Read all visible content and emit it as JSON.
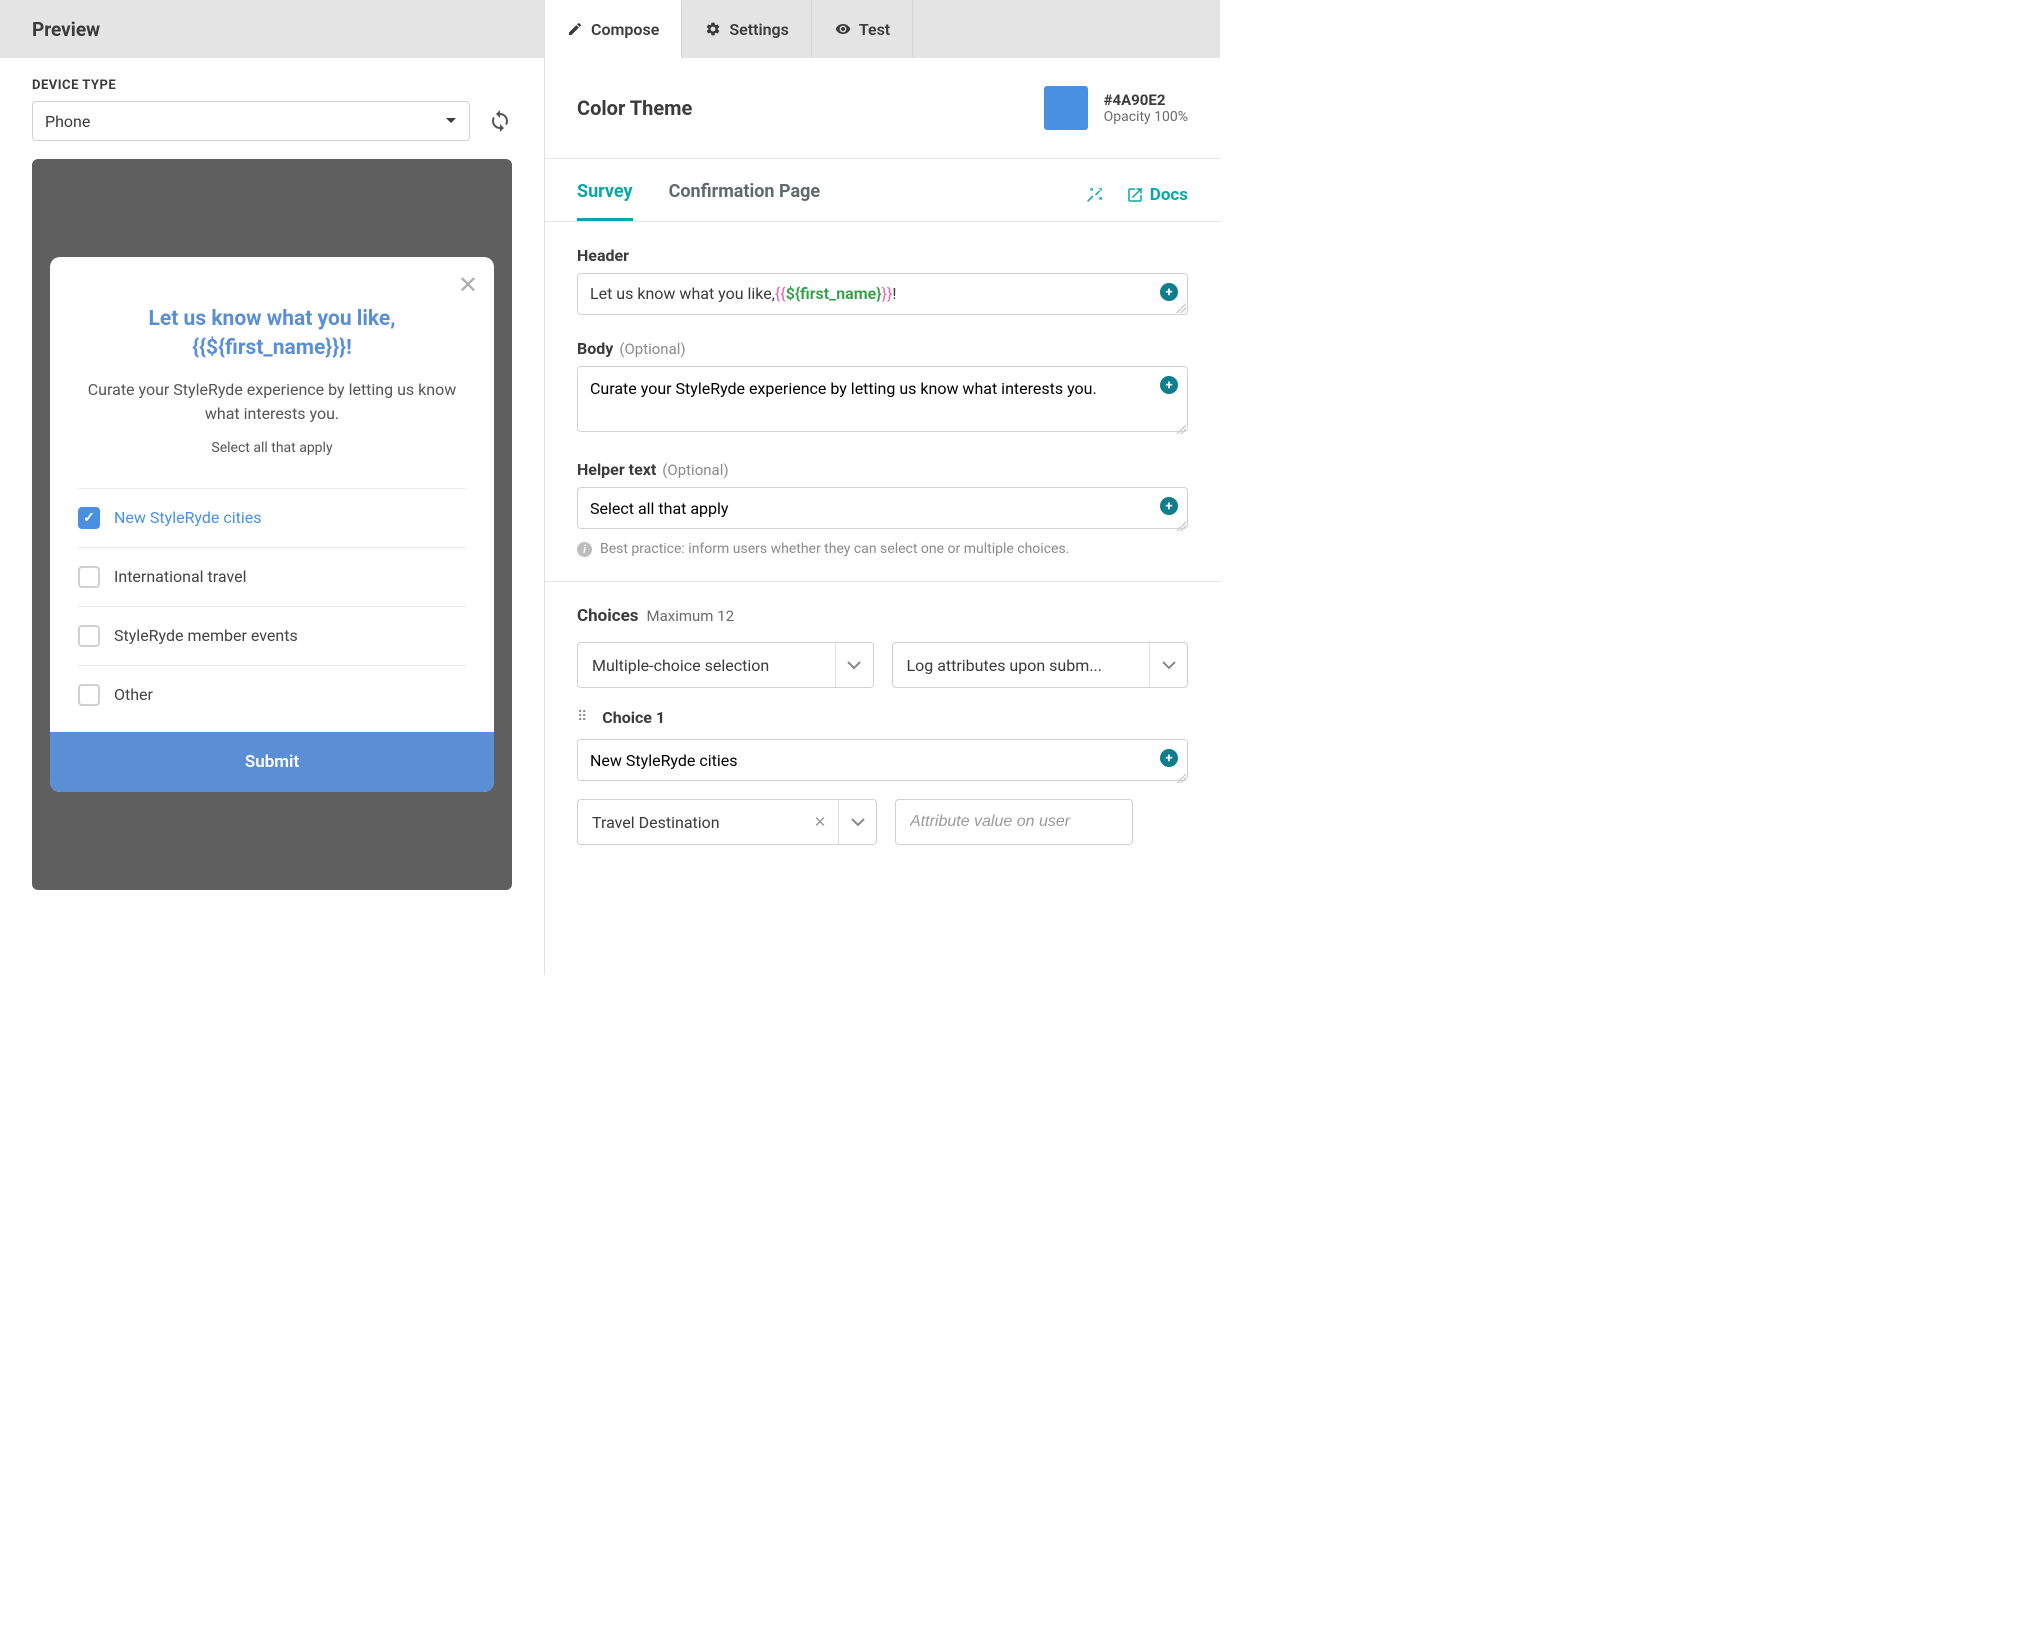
{
  "preview": {
    "title": "Preview",
    "device_type_label": "DEVICE TYPE",
    "device_type_value": "Phone"
  },
  "survey_preview": {
    "title_prefix": "Let us know what you like, ",
    "title_token": "{{${first_name}}}",
    "title_suffix": "!",
    "body": "Curate your StyleRyde experience by letting us know what interests you.",
    "helper": "Select all that apply",
    "choices": [
      {
        "label": "New StyleRyde cities",
        "checked": true
      },
      {
        "label": "International travel",
        "checked": false
      },
      {
        "label": "StyleRyde member events",
        "checked": false
      },
      {
        "label": "Other",
        "checked": false
      }
    ],
    "submit": "Submit"
  },
  "tabs": {
    "compose": "Compose",
    "settings": "Settings",
    "test": "Test"
  },
  "color_theme": {
    "title": "Color Theme",
    "hex": "#4A90E2",
    "opacity": "Opacity 100%"
  },
  "sub_tabs": {
    "survey": "Survey",
    "confirmation": "Confirmation Page",
    "docs": "Docs"
  },
  "form": {
    "header_label": "Header",
    "header_value_prefix": "Let us know what you like, ",
    "header_value_token": "{{${first_name}}}",
    "header_value_suffix": "!",
    "body_label": "Body",
    "optional": "(Optional)",
    "body_value": "Curate your StyleRyde experience by letting us know what interests you.",
    "helper_label": "Helper text",
    "helper_value": "Select all that apply",
    "helper_hint": "Best practice: inform users whether they can select one or multiple choices."
  },
  "choices_section": {
    "title": "Choices",
    "max": "Maximum 12",
    "selection_type": "Multiple-choice selection",
    "log_attrs": "Log attributes upon subm...",
    "choice1_title": "Choice 1",
    "choice1_value": "New StyleRyde cities",
    "choice1_attr_select": "Travel Destination",
    "choice1_attr_placeholder": "Attribute value on user"
  }
}
